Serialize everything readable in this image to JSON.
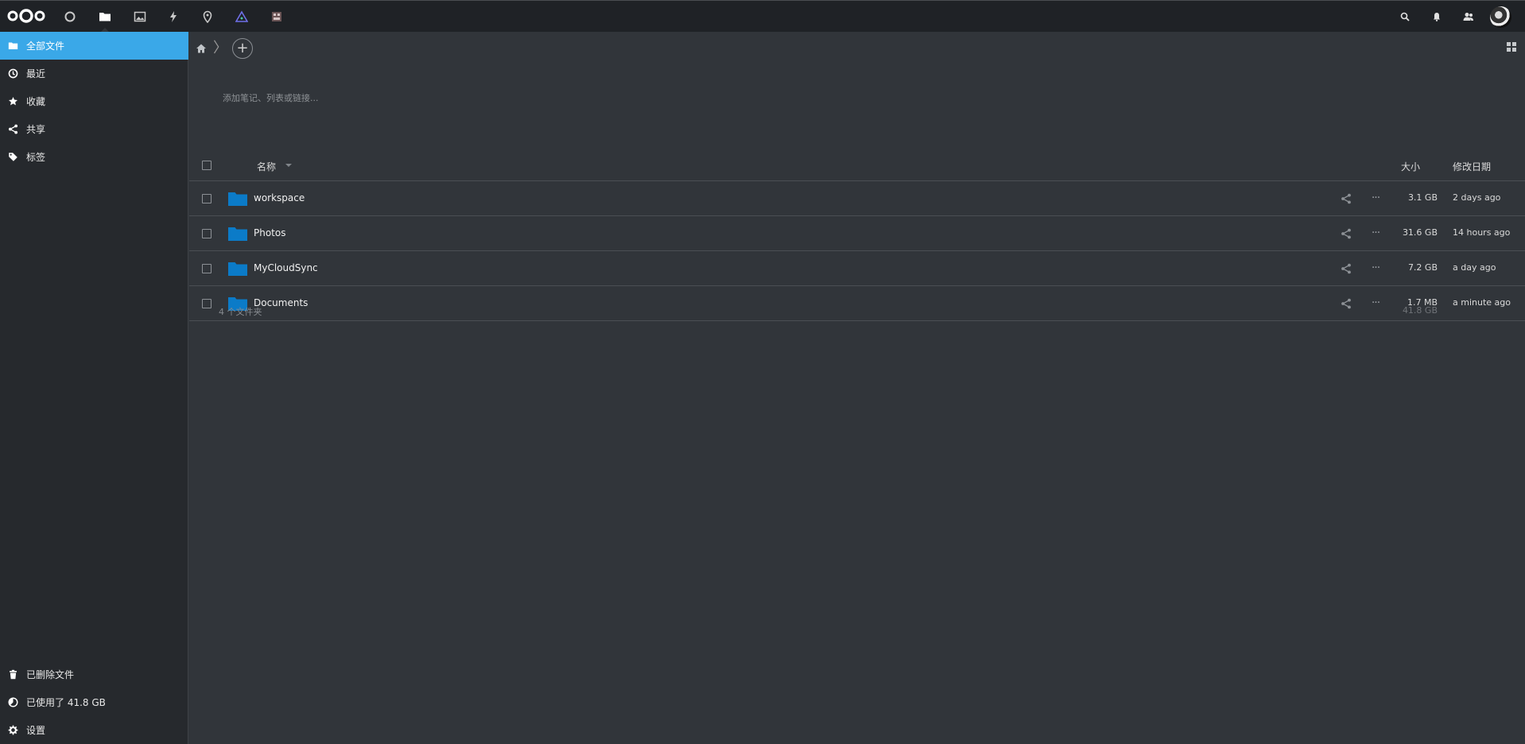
{
  "topbar": {
    "apps": [
      {
        "name": "dashboard",
        "icon": "circle-icon"
      },
      {
        "name": "files",
        "icon": "folder-icon"
      },
      {
        "name": "photos",
        "icon": "image-icon"
      },
      {
        "name": "activity",
        "icon": "lightning-icon"
      },
      {
        "name": "maps",
        "icon": "map-pin-icon"
      },
      {
        "name": "deck",
        "icon": "triangle-icon"
      },
      {
        "name": "office",
        "icon": "document-icon"
      }
    ],
    "right_icons": [
      "search-icon",
      "bell-icon",
      "contacts-icon"
    ]
  },
  "sidebar": {
    "items": [
      {
        "label": "全部文件",
        "icon": "folder-icon",
        "active": true
      },
      {
        "label": "最近",
        "icon": "clock-icon"
      },
      {
        "label": "收藏",
        "icon": "star-icon"
      },
      {
        "label": "共享",
        "icon": "share-icon"
      },
      {
        "label": "标签",
        "icon": "tag-icon"
      }
    ],
    "bottom": [
      {
        "label": "已删除文件",
        "icon": "trash-icon"
      },
      {
        "label": "已使用了 41.8 GB",
        "icon": "pie-icon"
      },
      {
        "label": "设置",
        "icon": "gear-icon"
      }
    ]
  },
  "main": {
    "note_placeholder": "添加笔记、列表或链接...",
    "add_label": "+",
    "columns": {
      "name": "名称",
      "size": "大小",
      "modified": "修改日期"
    },
    "files": [
      {
        "name": "workspace",
        "size": "3.1 GB",
        "modified": "2 days ago"
      },
      {
        "name": "Photos",
        "size": "31.6 GB",
        "modified": "14 hours ago"
      },
      {
        "name": "MyCloudSync",
        "size": "7.2 GB",
        "modified": "a day ago"
      },
      {
        "name": "Documents",
        "size": "1.7 MB",
        "modified": "a minute ago"
      }
    ],
    "summary": {
      "count": "4 个文件夹",
      "total": "41.8 GB"
    }
  },
  "colors": {
    "accent": "#3aa8e8",
    "folder": "#0b7bc8",
    "background": "#31353a",
    "sidebar": "#26292d",
    "topbar": "#1f2226"
  }
}
